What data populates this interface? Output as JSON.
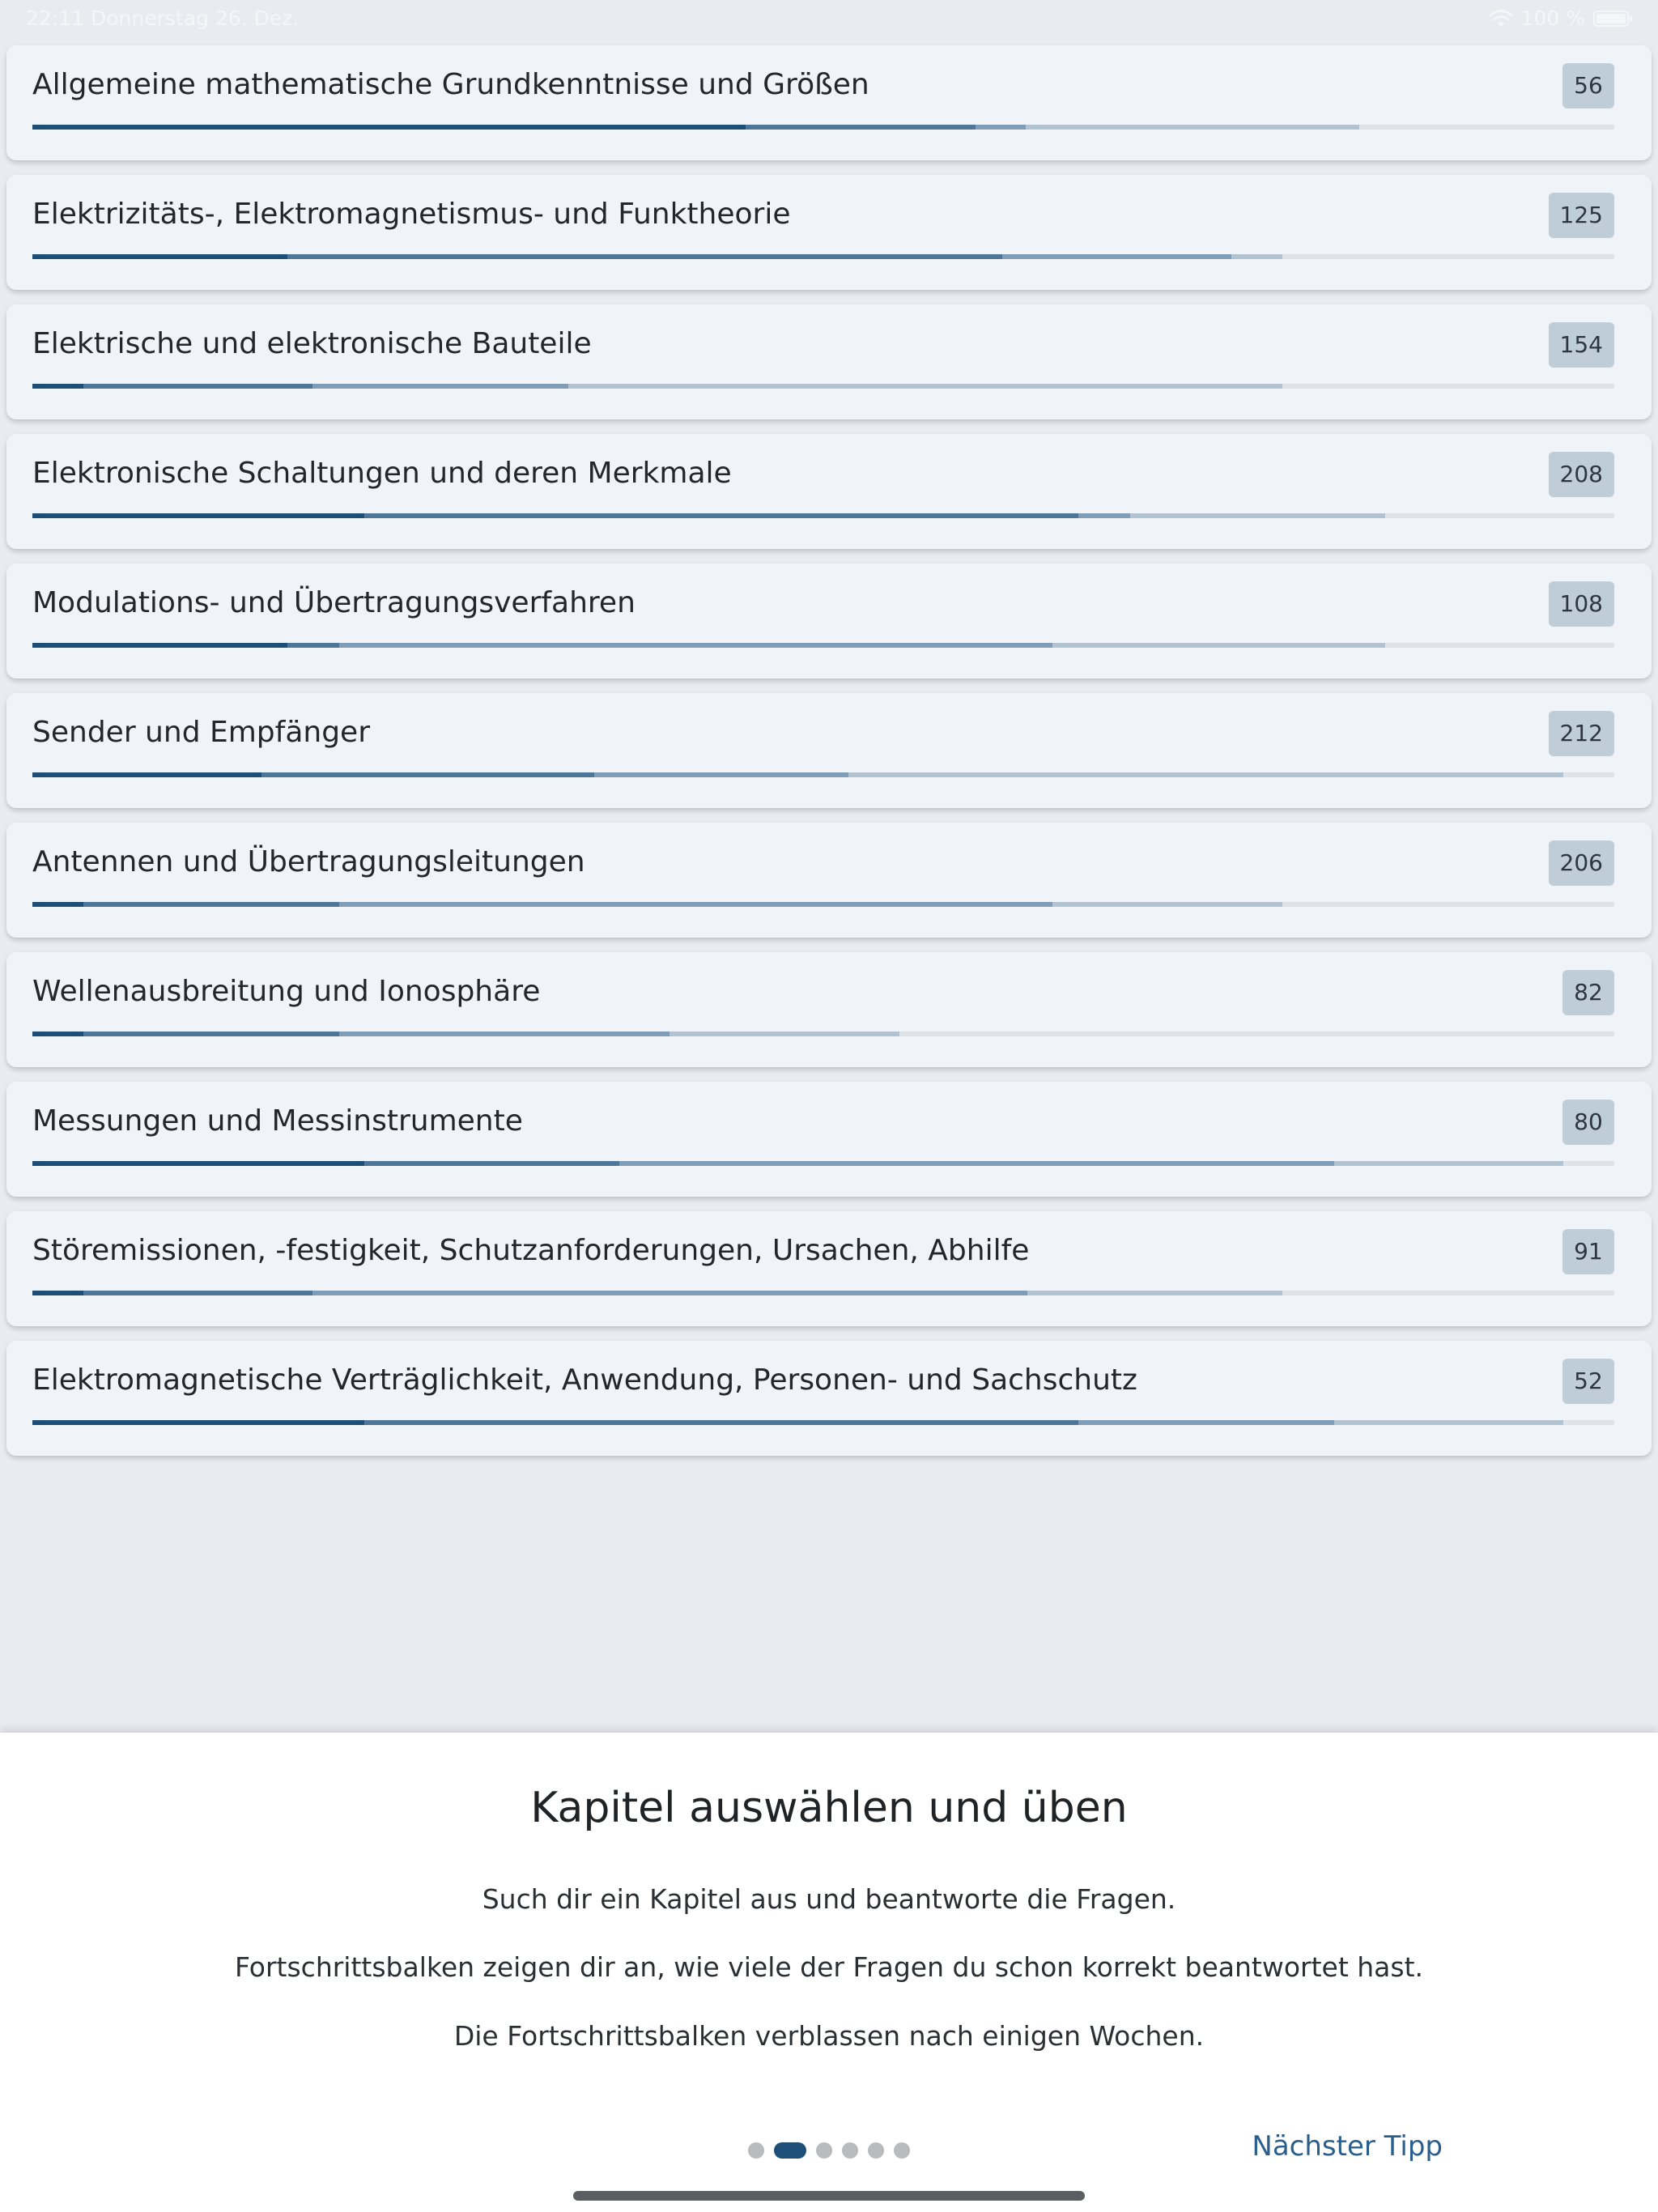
{
  "status_bar": {
    "time": "22:11",
    "date": "Donnerstag 26. Dez.",
    "battery": "100 %",
    "icons": [
      "wifi-icon",
      "battery-icon"
    ]
  },
  "colors": {
    "accent": "#1e4f78",
    "progress_shades": [
      "#1e4f78",
      "#4e7698",
      "#7f9db6",
      "#b1c2d1"
    ],
    "track": "#dfe2e6",
    "badge": "#bfcdd8"
  },
  "chapters": [
    {
      "title": "Allgemeine mathematische Grundkenntnisse und Größen",
      "count": "56",
      "progress": [
        0.451,
        0.596,
        0.628,
        0.839
      ]
    },
    {
      "title": "Elektrizitäts-, Elektromagnetismus- und Funktheorie",
      "count": "125",
      "progress": [
        0.161,
        0.613,
        0.758,
        0.79
      ]
    },
    {
      "title": "Elektrische und elektronische Bauteile",
      "count": "154",
      "progress": [
        0.032,
        0.177,
        0.339,
        0.79
      ]
    },
    {
      "title": "Elektronische Schaltungen und deren Merkmale",
      "count": "208",
      "progress": [
        0.21,
        0.661,
        0.694,
        0.855
      ]
    },
    {
      "title": "Modulations- und Übertragungsverfahren",
      "count": "108",
      "progress": [
        0.161,
        0.194,
        0.645,
        0.855
      ]
    },
    {
      "title": "Sender und Empfänger",
      "count": "212",
      "progress": [
        0.145,
        0.355,
        0.516,
        0.968
      ]
    },
    {
      "title": "Antennen und Übertragungsleitungen",
      "count": "206",
      "progress": [
        0.032,
        0.194,
        0.645,
        0.79
      ]
    },
    {
      "title": "Wellenausbreitung und Ionosphäre",
      "count": "82",
      "progress": [
        0.032,
        0.194,
        0.403,
        0.548
      ]
    },
    {
      "title": "Messungen und Messinstrumente",
      "count": "80",
      "progress": [
        0.21,
        0.371,
        0.823,
        0.968
      ]
    },
    {
      "title": "Störemissionen, -festigkeit, Schutzanforderungen, Ursachen, Abhilfe",
      "count": "91",
      "progress": [
        0.032,
        0.177,
        0.629,
        0.79
      ]
    },
    {
      "title": "Elektromagnetische Verträglichkeit, Anwendung, Personen- und Sachschutz",
      "count": "52",
      "progress": [
        0.21,
        0.661,
        0.823,
        0.968
      ]
    }
  ],
  "tip": {
    "title": "Kapitel auswählen und üben",
    "paragraphs": [
      "Such dir ein Kapitel aus und beantworte die Fragen.",
      "Fortschrittsbalken zeigen dir an, wie viele der Fragen du schon korrekt beantwortet hast.",
      "Die Fortschrittsbalken verblassen nach einigen Wochen."
    ],
    "page_count": 6,
    "active_page": 2,
    "next_label": "Nächster Tipp"
  }
}
